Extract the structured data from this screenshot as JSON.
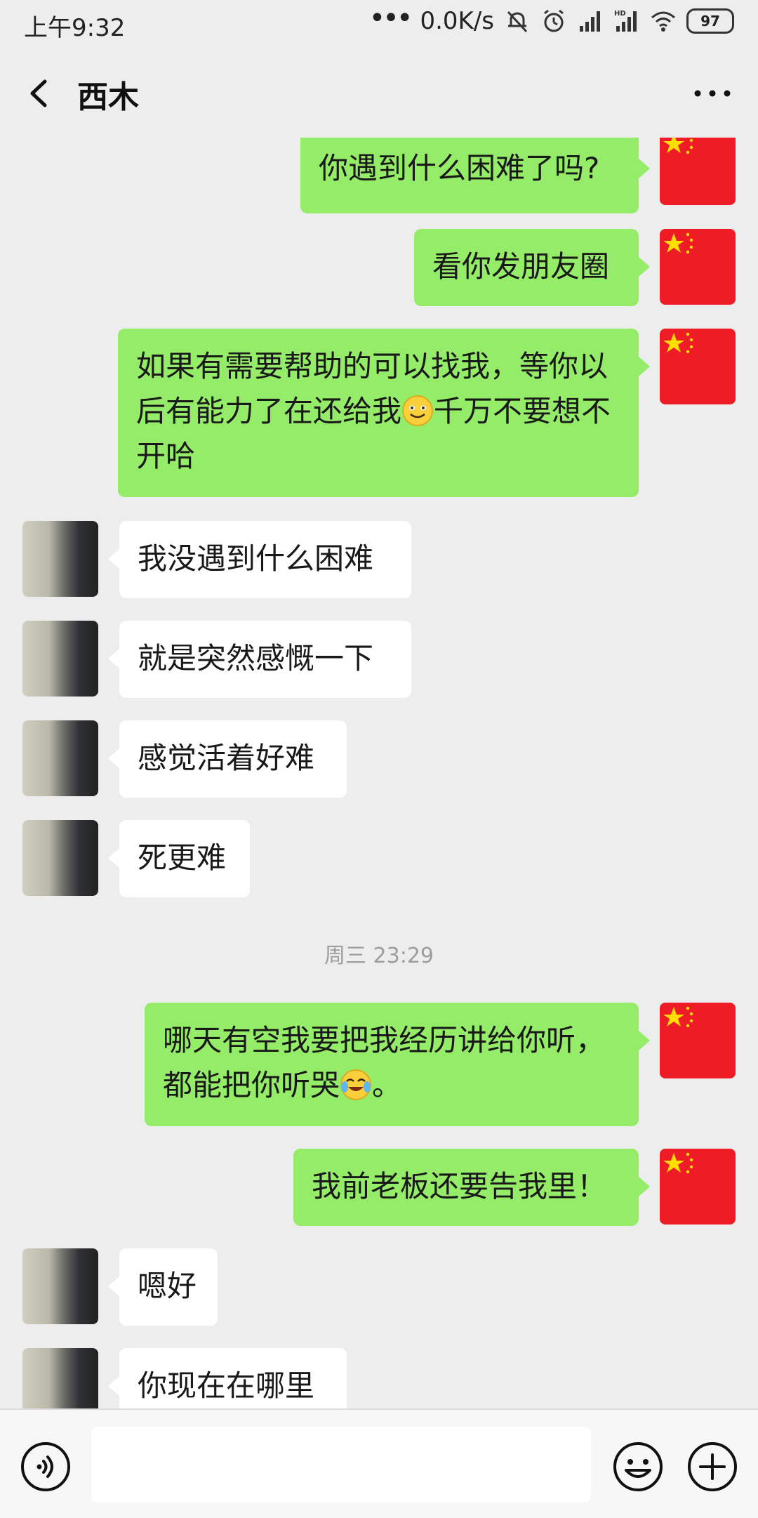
{
  "status_bar": {
    "time": "上午9:32",
    "network_speed": "0.0K/s",
    "battery": "97",
    "icons": [
      "more-dots-icon",
      "mute-bell-icon",
      "alarm-icon",
      "signal-icon",
      "hd-signal-icon",
      "wifi-icon",
      "battery-icon"
    ]
  },
  "header": {
    "title": "西木",
    "back_icon": "chevron-left-icon",
    "more_icon": "more-horizontal-icon"
  },
  "messages": [
    {
      "direction": "out",
      "avatar": "china-flag-avatar",
      "text": "你遇到什么困难了吗?"
    },
    {
      "direction": "out",
      "avatar": "china-flag-avatar",
      "text": "看你发朋友圈"
    },
    {
      "direction": "out",
      "avatar": "china-flag-avatar",
      "text_part1": "如果有需要帮助的可以找我，等你以后有能力了在还给我",
      "emoji": "smile-emoji",
      "text_part2": "千万不要想不开哈"
    },
    {
      "direction": "in",
      "avatar": "contact-photo-avatar",
      "text": "我没遇到什么困难"
    },
    {
      "direction": "in",
      "avatar": "contact-photo-avatar",
      "text": "就是突然感慨一下"
    },
    {
      "direction": "in",
      "avatar": "contact-photo-avatar",
      "text": "感觉活着好难"
    },
    {
      "direction": "in",
      "avatar": "contact-photo-avatar",
      "text": "死更难"
    },
    {
      "direction": "out",
      "avatar": "china-flag-avatar",
      "text_part1": "哪天有空我要把我经历讲给你听，都能把你听哭",
      "emoji": "crying-laughing-emoji",
      "text_part2": "。"
    },
    {
      "direction": "out",
      "avatar": "china-flag-avatar",
      "text": "我前老板还要告我里！"
    },
    {
      "direction": "in",
      "avatar": "contact-photo-avatar",
      "text": "嗯好"
    },
    {
      "direction": "in",
      "avatar": "contact-photo-avatar",
      "text": "你现在在哪里"
    }
  ],
  "time_divider": "周三 23:29",
  "input_bar": {
    "voice_icon": "voice-icon",
    "input_value": "",
    "emoji_icon": "emoji-icon",
    "plus_icon": "plus-icon"
  },
  "colors": {
    "background": "#ededed",
    "outgoing_bubble": "#95ec69",
    "incoming_bubble": "#ffffff",
    "flag_red": "#ee1c25",
    "flag_star": "#ffde00"
  }
}
